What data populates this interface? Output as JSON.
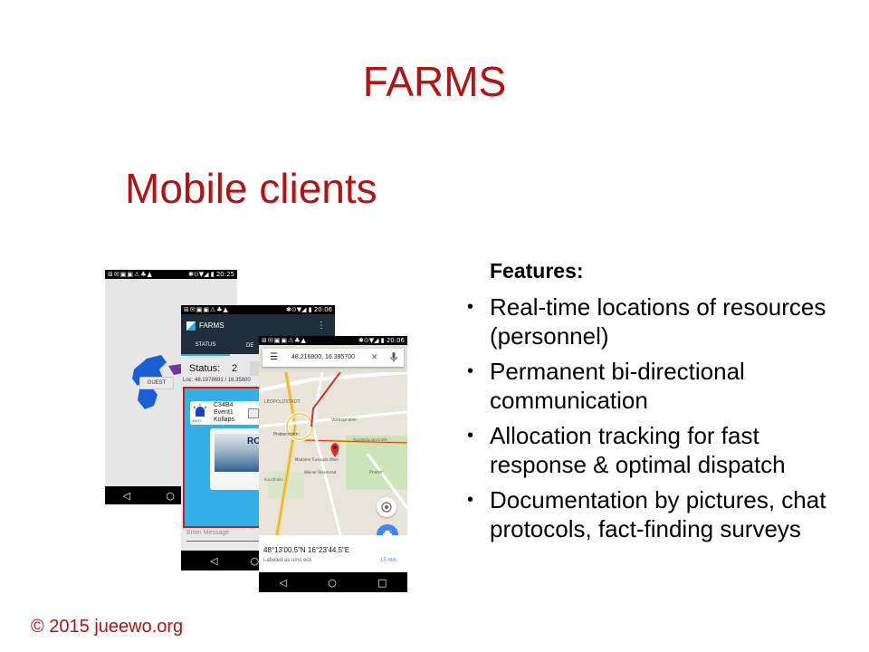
{
  "slide": {
    "title": "FARMS",
    "subtitle": "Mobile clients",
    "features_heading": "Features:",
    "bullet_glyph": "•",
    "features": [
      "Real-time locations of resources (personnel)",
      "Permanent bi-directional communication",
      "Allocation tracking for fast response & optimal dispatch",
      "Documentation by pictures, chat protocols, fact-finding surveys"
    ],
    "footer": "© 2015 jueewo.org"
  },
  "colors": {
    "accent": "#b01414",
    "appbar": "#1f2e3a",
    "panel_blue": "#34b0e8",
    "tab_indicator": "#27a9e1",
    "map_pin": "#d93025",
    "eta_blue": "#4285f4"
  },
  "phone1": {
    "status_icons": "⊞✉▣▣⚠♣▲",
    "status_right": "✱⊙▼◢ ▮ 20:25",
    "guest_label": "GUEST",
    "nav": [
      "◁",
      "○",
      "□"
    ]
  },
  "phone2": {
    "status_icons": "⊞✉▣▣⚠♣▲",
    "status_right": "✱⊙▼◢ ▮ 20:06",
    "app_title": "FARMS",
    "menu_icon": "⋮",
    "tabs": [
      "STATUS",
      "DE"
    ],
    "status_label": "Status:",
    "status_value": "2",
    "loc_text": "Loc: 48.1978691 / 16.35800",
    "event": {
      "code": "C34B4",
      "name": "Event1",
      "type": "Kollaps",
      "small": "39/03",
      "map_icon": "map-icon"
    },
    "photo_text": "RO",
    "message_placeholder": "Enter Message",
    "nav": [
      "◁",
      "○"
    ]
  },
  "phone3": {
    "status_icons": "⊞✉▣▣⚠♣▲",
    "status_right": "✱⊙▼◢ ▮ 20:06",
    "search_menu": "☰",
    "search_text": "48.216800, 16.395700",
    "search_close": "✕",
    "search_mic": "mic-icon",
    "map_labels": [
      "LEOPOLDSTADT",
      "Volksprater",
      "Praterstern",
      "Ausstellungsstraße",
      "Weiner Riesenrad",
      "Prater",
      "Madame Tussauds Wien",
      "Kunsthalle"
    ],
    "coords": "48°13'00.5\"N 16°23'44.5\"E",
    "labeled_as": "Labeled as ums eck",
    "eta": "15 min",
    "nav": [
      "◁",
      "○",
      "□"
    ]
  }
}
